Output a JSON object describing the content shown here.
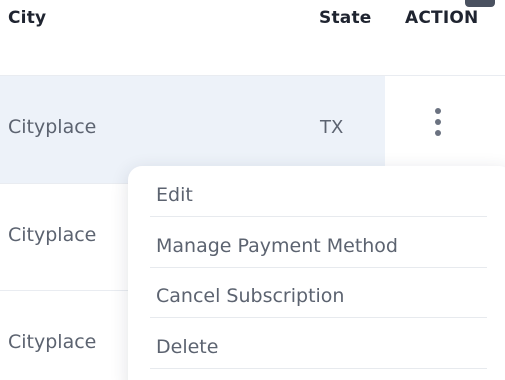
{
  "table": {
    "headers": {
      "city": "City",
      "state": "State",
      "action": "ACTION"
    },
    "rows": [
      {
        "city": "Cityplace",
        "state": "TX"
      },
      {
        "city": "Cityplace",
        "state": ""
      },
      {
        "city": "Cityplace",
        "state": ""
      }
    ]
  },
  "action_menu": {
    "items": [
      "Edit",
      "Manage Payment Method",
      "Cancel Subscription",
      "Delete"
    ]
  },
  "icons": {
    "row_action": "kebab-menu-icon"
  },
  "colors": {
    "highlight_row": "#edf2f9",
    "text_muted": "#5c6370",
    "header_text": "#1f2430"
  }
}
